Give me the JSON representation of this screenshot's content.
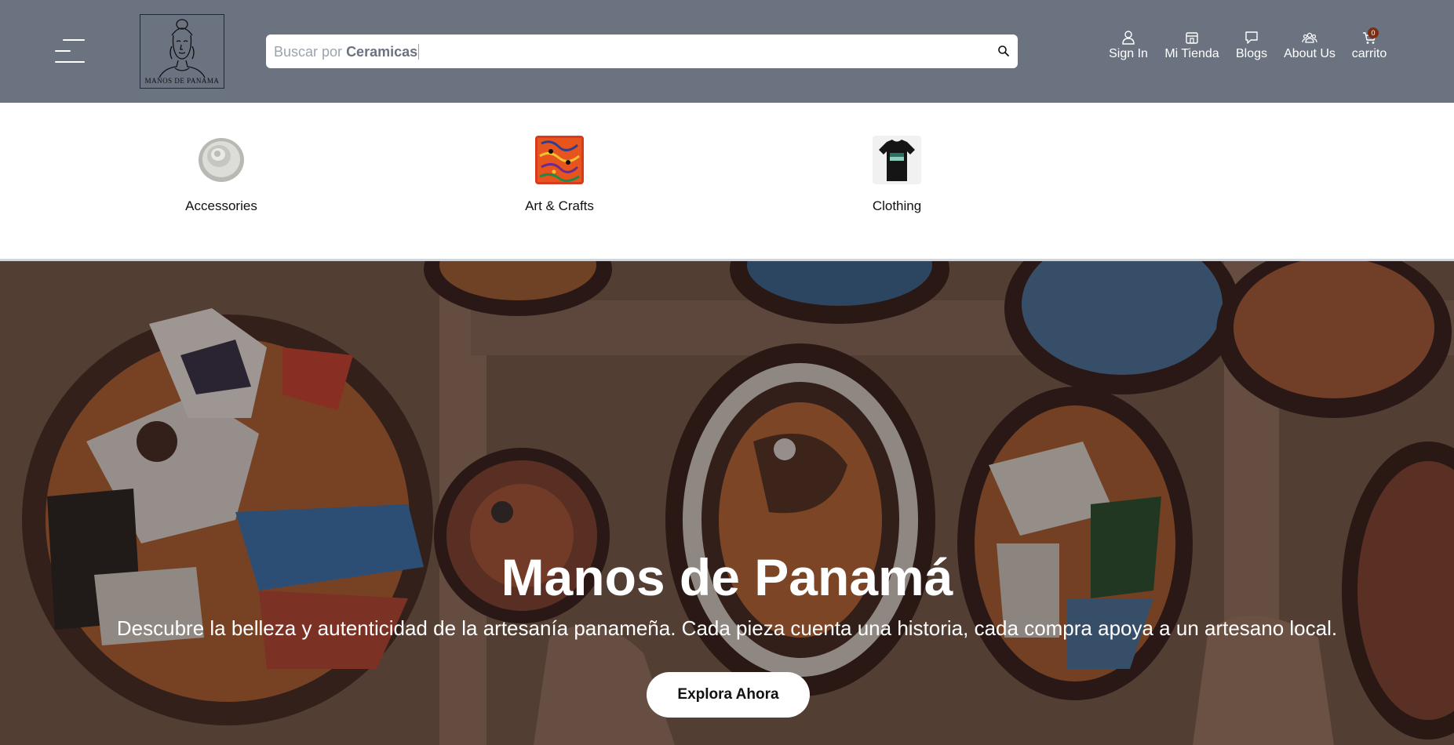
{
  "header": {
    "logo_text": "MANOS DE PANAMA",
    "search": {
      "prefix": "Buscar por",
      "keyword": "Ceramicas"
    },
    "nav": [
      {
        "label": "Sign In",
        "icon": "user-icon"
      },
      {
        "label": "Mi Tienda",
        "icon": "store-icon"
      },
      {
        "label": "Blogs",
        "icon": "chat-icon"
      },
      {
        "label": "About Us",
        "icon": "team-icon"
      },
      {
        "label": "carrito",
        "icon": "cart-icon",
        "badge": "0"
      }
    ]
  },
  "categories": [
    {
      "label": "Accessories",
      "icon": "ceramic-plate-thumbnail"
    },
    {
      "label": "Art & Crafts",
      "icon": "mola-art-thumbnail"
    },
    {
      "label": "Clothing",
      "icon": "tshirt-thumbnail"
    }
  ],
  "hero": {
    "title": "Manos de Panamá",
    "subtitle": "Descubre la belleza y autenticidad de la artesanía panameña. Cada pieza cuenta una historia, cada compra apoya a un artesano local.",
    "cta": "Explora Ahora"
  },
  "colors": {
    "header_bg": "#6b7280",
    "badge_bg": "#7c2d12",
    "hero_text": "#ffffff"
  }
}
